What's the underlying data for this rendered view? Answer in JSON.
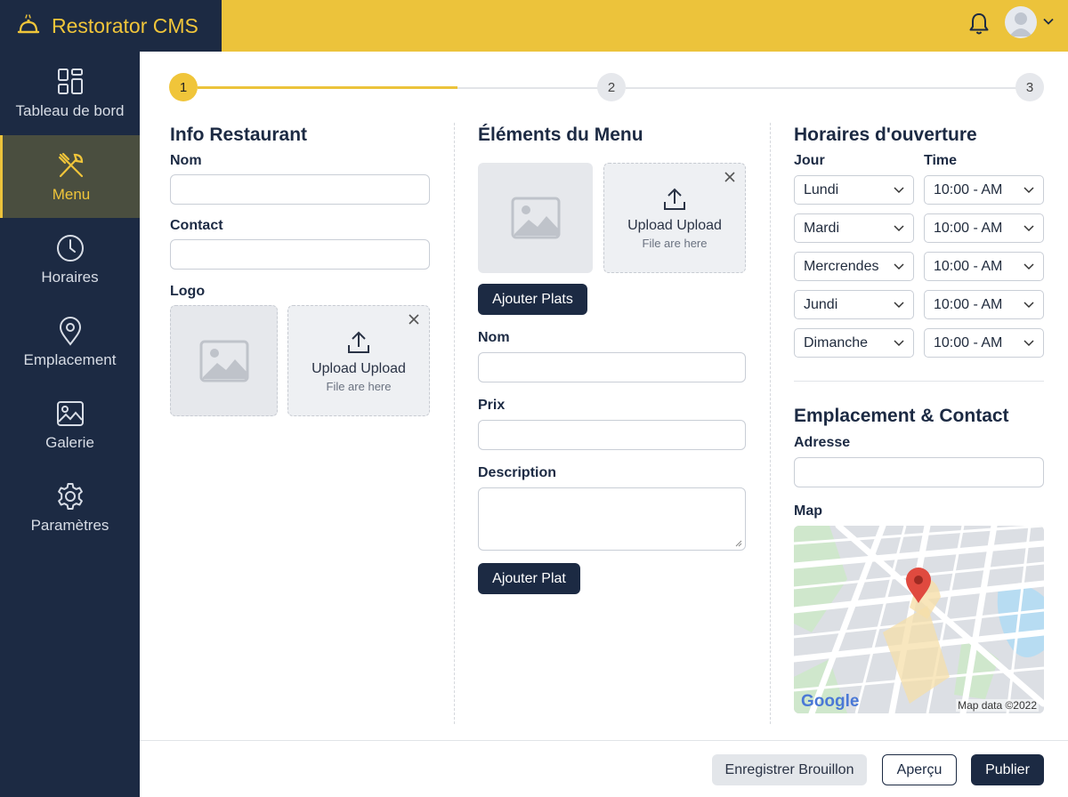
{
  "app": {
    "title": "Restorator CMS"
  },
  "sidebar": {
    "items": [
      {
        "label": "Tableau de bord",
        "icon": "dashboard-icon"
      },
      {
        "label": "Menu",
        "icon": "utensils-icon",
        "active": true
      },
      {
        "label": "Horaires",
        "icon": "clock-icon"
      },
      {
        "label": "Emplacement",
        "icon": "location-pin-icon"
      },
      {
        "label": "Galerie",
        "icon": "image-icon"
      },
      {
        "label": "Paramètres",
        "icon": "gear-icon"
      }
    ]
  },
  "stepper": {
    "steps": [
      "1",
      "2",
      "3"
    ],
    "current": 1
  },
  "info": {
    "title": "Info Restaurant",
    "nom_label": "Nom",
    "contact_label": "Contact",
    "logo_label": "Logo",
    "upload_title": "Upload Upload",
    "upload_sub": "File are here"
  },
  "menu": {
    "title": "Éléments du Menu",
    "upload_title": "Upload Upload",
    "upload_sub": "File are here",
    "add_plats_label": "Ajouter Plats",
    "nom_label": "Nom",
    "prix_label": "Prix",
    "description_label": "Description",
    "add_plat_label": "Ajouter Plat"
  },
  "hours": {
    "title": "Horaires d'ouverture",
    "jour_label": "Jour",
    "time_label": "Time",
    "rows": [
      {
        "day": "Lundi",
        "time": "10:00 - AM"
      },
      {
        "day": "Mardi",
        "time": "10:00 - AM"
      },
      {
        "day": "Mercrendes",
        "time": "10:00 - AM"
      },
      {
        "day": "Jundi",
        "time": "10:00 - AM"
      },
      {
        "day": "Dimanche",
        "time": "10:00 - AM"
      }
    ]
  },
  "location": {
    "title": "Emplacement & Contact",
    "adresse_label": "Adresse",
    "map_label": "Map",
    "map_credit": "Map data ©2022",
    "map_brand": "Google"
  },
  "footer": {
    "draft_label": "Enregistrer Brouillon",
    "preview_label": "Aperçu",
    "publish_label": "Publier"
  },
  "colors": {
    "accent": "#ecc33b",
    "navy": "#1c2a43",
    "map_pin": "#e04a3f"
  }
}
